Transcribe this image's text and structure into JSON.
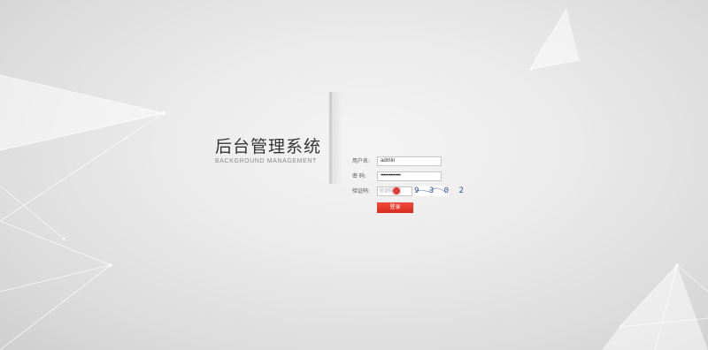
{
  "brand": {
    "title": "后台管理系统",
    "subtitle": "BACKGROUND MANAGEMENT"
  },
  "form": {
    "username_label": "用户名:",
    "username_value": "admin",
    "password_label": "密 码:",
    "password_value": "••••••••••••••",
    "captcha_label": "验证码:",
    "captcha_placeholder": "验证码",
    "captcha_image_text": "9 3 0 2",
    "login_label": "登录"
  },
  "colors": {
    "accent": "#e53935",
    "background": "#e6e6e6",
    "captcha_text": "#2f4a8a"
  }
}
